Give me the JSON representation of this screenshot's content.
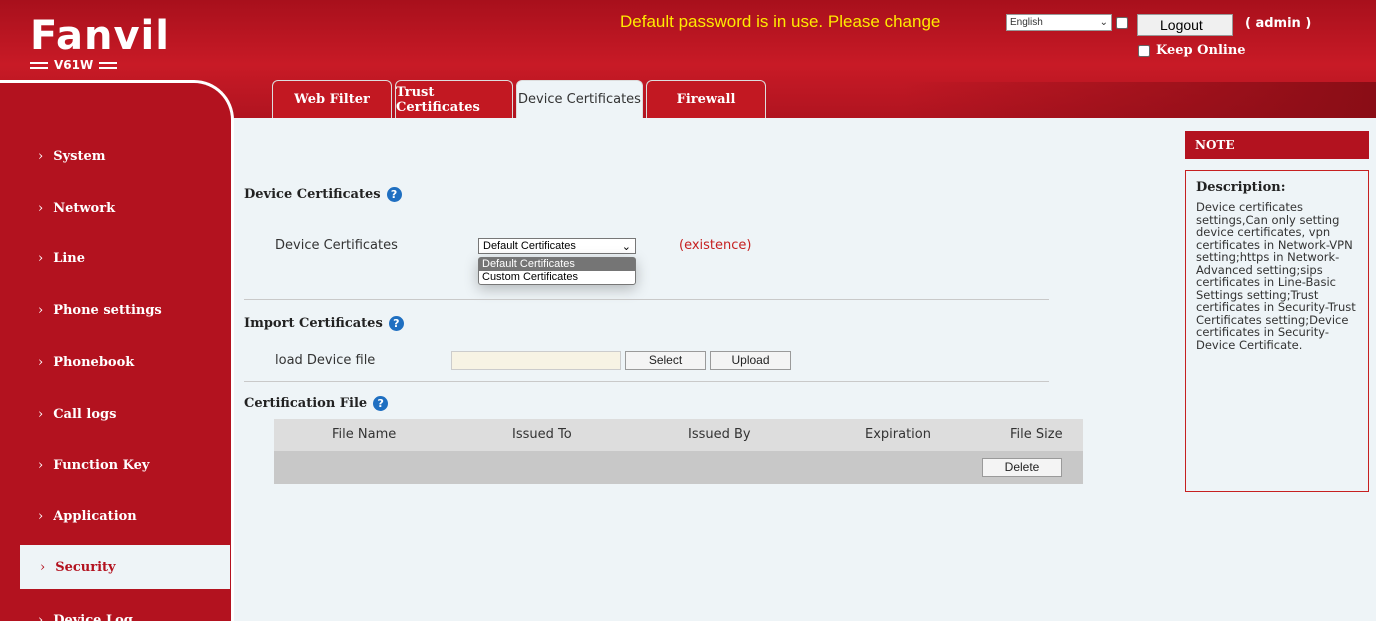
{
  "header": {
    "brand": "Fanvil",
    "model": "V61W",
    "warning": "Default password is in use. Please change",
    "language": "English",
    "logout_label": "Logout",
    "user": "( admin )",
    "keep_online_label": "Keep Online"
  },
  "tabs": [
    {
      "label": "Web Filter",
      "active": false
    },
    {
      "label": "Trust Certificates",
      "active": false
    },
    {
      "label": "Device Certificates",
      "active": true
    },
    {
      "label": "Firewall",
      "active": false
    }
  ],
  "sidebar": {
    "items": [
      {
        "label": "System"
      },
      {
        "label": "Network"
      },
      {
        "label": "Line"
      },
      {
        "label": "Phone settings"
      },
      {
        "label": "Phonebook"
      },
      {
        "label": "Call logs"
      },
      {
        "label": "Function Key"
      },
      {
        "label": "Application"
      },
      {
        "label": "Security",
        "active": true
      },
      {
        "label": "Device Log"
      }
    ]
  },
  "device_certificates": {
    "title": "Device Certificates",
    "field_label": "Device Certificates",
    "selected": "Default Certificates",
    "options": [
      "Default Certificates",
      "Custom Certificates"
    ],
    "status": "(existence)"
  },
  "import_certificates": {
    "title": "Import Certificates",
    "field_label": "load Device file",
    "select_label": "Select",
    "upload_label": "Upload"
  },
  "certification_file": {
    "title": "Certification File",
    "columns": [
      "File Name",
      "Issued To",
      "Issued By",
      "Expiration",
      "File Size"
    ],
    "delete_label": "Delete"
  },
  "note": {
    "heading": "NOTE",
    "title": "Description:",
    "text": "Device certificates settings,Can only setting device certificates, vpn certificates in Network-VPN setting;https in Network-Advanced setting;sips certificates in Line-Basic Settings setting;Trust certificates in Security-Trust Certificates setting;Device certificates in Security-Device Certificate."
  },
  "colors": {
    "brand_red": "#b3121f",
    "warning_yellow": "#ffea00",
    "help_blue": "#1f6fc1"
  }
}
